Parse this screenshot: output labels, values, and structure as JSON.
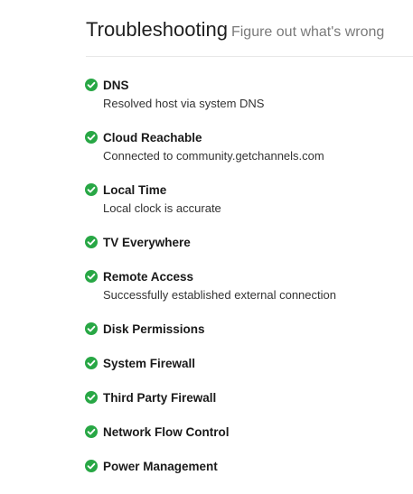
{
  "header": {
    "title": "Troubleshooting",
    "subtitle": "Figure out what's wrong"
  },
  "colors": {
    "ok": "#28a745",
    "text": "#1a1a1a",
    "muted": "#7a7a7a"
  },
  "checks": [
    {
      "title": "DNS",
      "detail": "Resolved host via system DNS",
      "status": "ok",
      "icon": "check-circle-icon"
    },
    {
      "title": "Cloud Reachable",
      "detail": "Connected to community.getchannels.com",
      "status": "ok",
      "icon": "check-circle-icon"
    },
    {
      "title": "Local Time",
      "detail": "Local clock is accurate",
      "status": "ok",
      "icon": "check-circle-icon"
    },
    {
      "title": "TV Everywhere",
      "detail": "",
      "status": "ok",
      "icon": "check-circle-icon"
    },
    {
      "title": "Remote Access",
      "detail": "Successfully established external connection",
      "status": "ok",
      "icon": "check-circle-icon"
    },
    {
      "title": "Disk Permissions",
      "detail": "",
      "status": "ok",
      "icon": "check-circle-icon"
    },
    {
      "title": "System Firewall",
      "detail": "",
      "status": "ok",
      "icon": "check-circle-icon"
    },
    {
      "title": "Third Party Firewall",
      "detail": "",
      "status": "ok",
      "icon": "check-circle-icon"
    },
    {
      "title": "Network Flow Control",
      "detail": "",
      "status": "ok",
      "icon": "check-circle-icon"
    },
    {
      "title": "Power Management",
      "detail": "",
      "status": "ok",
      "icon": "check-circle-icon"
    }
  ]
}
